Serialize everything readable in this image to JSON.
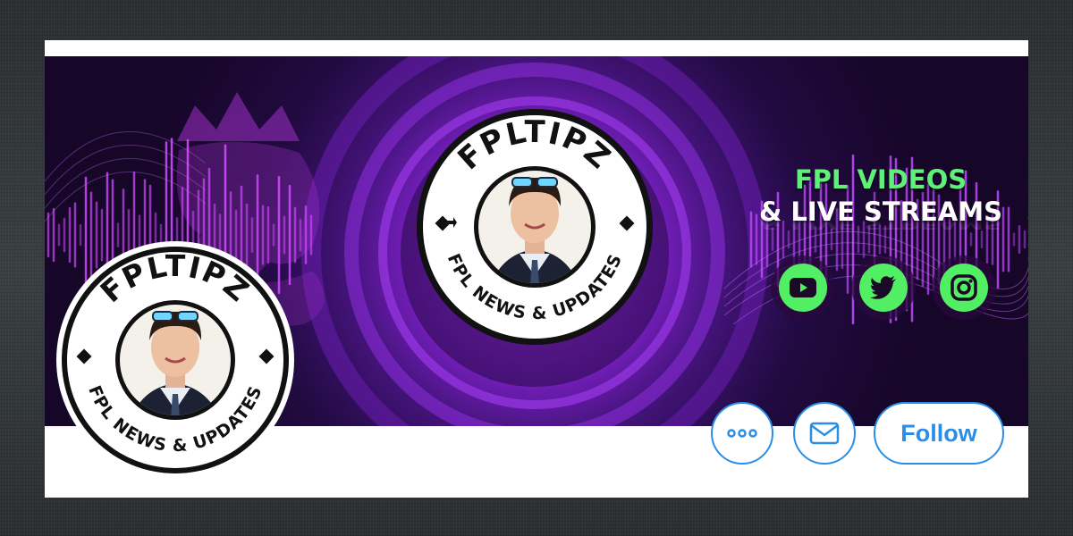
{
  "badge": {
    "top_text": "FPLTIPZ",
    "bottom_text": "FPL NEWS & UPDATES"
  },
  "banner": {
    "headline_line1": "FPL VIDEOS",
    "headline_line2": "& LIVE STREAMS",
    "social_icons": [
      "youtube-icon",
      "twitter-icon",
      "instagram-icon"
    ],
    "accent_green": "#52ee63",
    "accent_purple": "#b52bf0"
  },
  "actions": {
    "more_icon": "more-icon",
    "message_icon": "mail-icon",
    "follow_label": "Follow",
    "accent_blue": "#2b8ee6"
  }
}
